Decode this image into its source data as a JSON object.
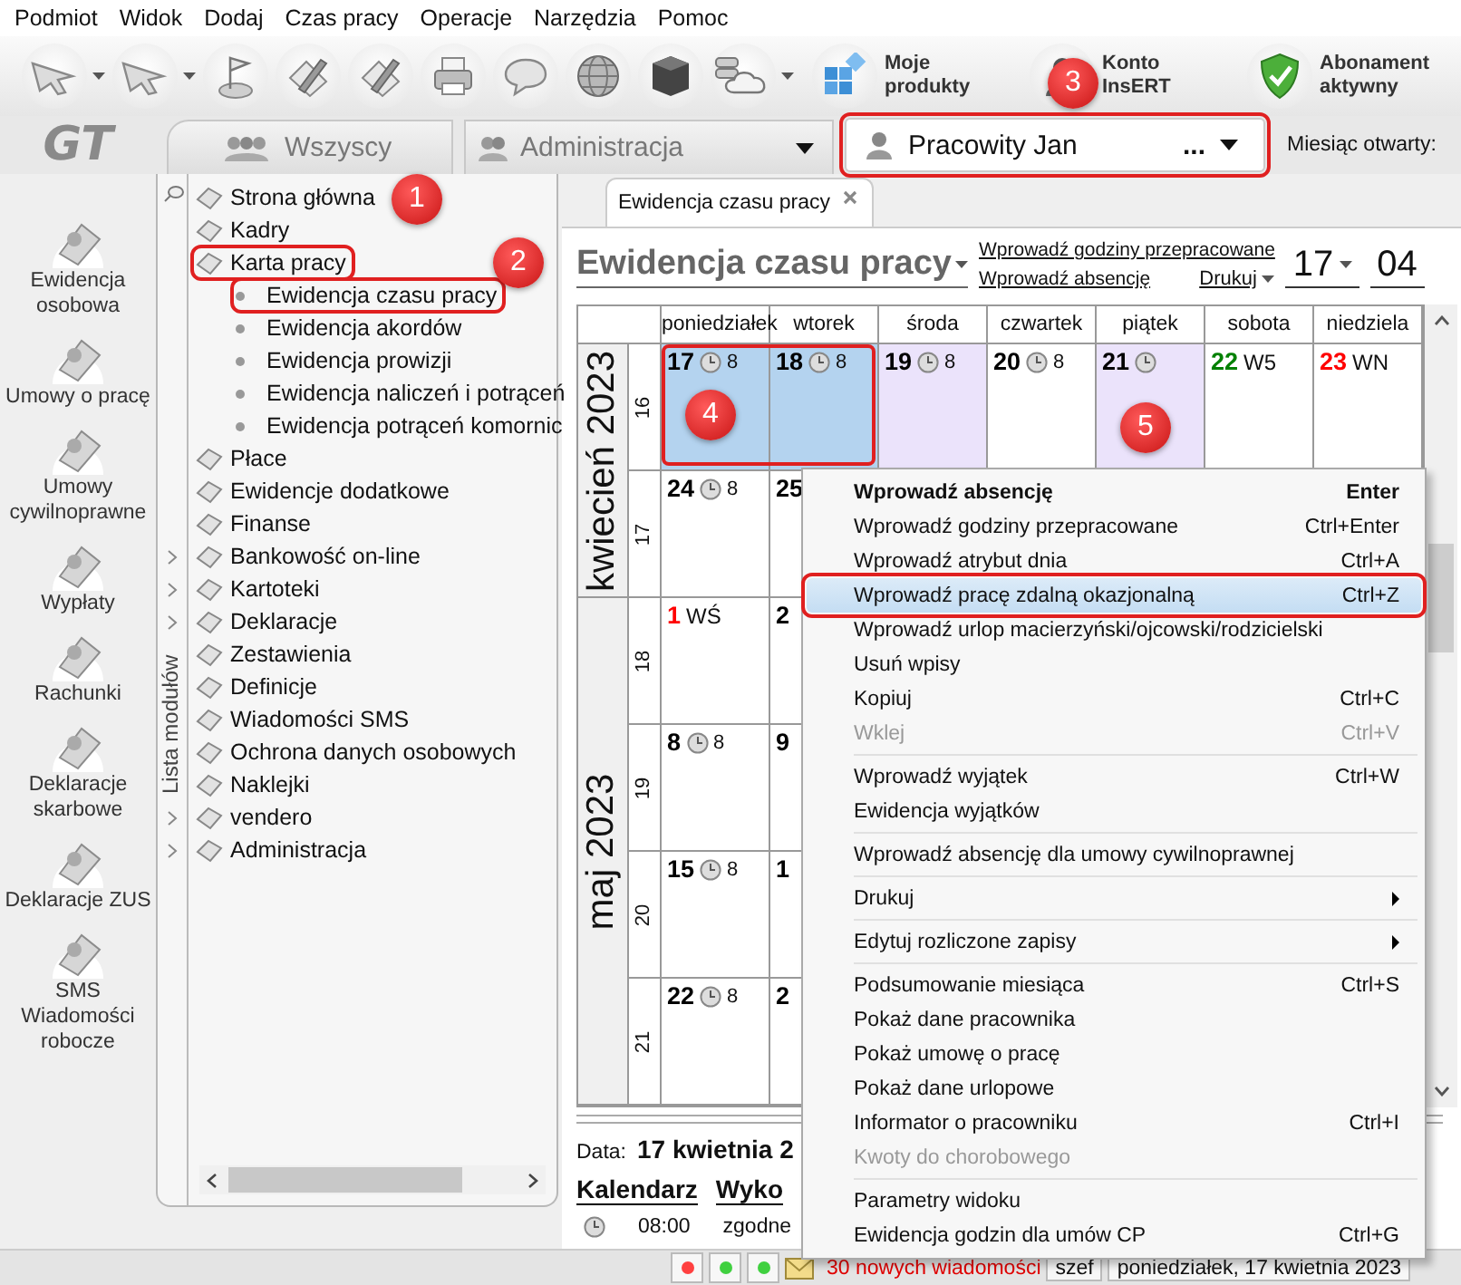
{
  "menubar": [
    "Podmiot",
    "Widok",
    "Dodaj",
    "Czas pracy",
    "Operacje",
    "Narzędzia",
    "Pomoc"
  ],
  "toolbar": [
    {
      "dropdown": true
    },
    {
      "dropdown": true
    },
    {
      "dropdown": false
    },
    {
      "dropdown": false
    },
    {
      "dropdown": false
    },
    {
      "dropdown": false
    },
    {
      "dropdown": false
    },
    {
      "dropdown": false
    },
    {
      "dropdown": false
    },
    {
      "dropdown": true
    },
    {
      "label": "Moje produkty",
      "dropdown": false
    },
    {
      "label": "Konto InsERT",
      "dropdown": false
    },
    {
      "label": "Abonament aktywny",
      "dropdown": false
    }
  ],
  "logo": "GT",
  "group_tab": {
    "label": "Wszyscy"
  },
  "group_dropdown": {
    "value": "Administracja"
  },
  "employee_selector": {
    "value": "Pracowity Jan",
    "more": "...",
    "outlined": true
  },
  "month_open_label": "Miesiąc otwarty:",
  "nav": [
    "Ewidencja osobowa",
    "Umowy o pracę",
    "Umowy cywilnoprawne",
    "Wypłaty",
    "Rachunki",
    "Deklaracje skarbowe",
    "Deklaracje ZUS",
    "SMS Wiadomości robocze"
  ],
  "modules": {
    "title": "Lista modułów",
    "items": [
      {
        "label": "Strona główna",
        "outlined": false
      },
      {
        "label": "Kadry",
        "outlined": false
      },
      {
        "label": "Karta pracy",
        "outlined": true,
        "children": [
          {
            "label": "Ewidencja czasu pracy",
            "outlined": true
          },
          {
            "label": "Ewidencja akordów",
            "outlined": false
          },
          {
            "label": "Ewidencja prowizji",
            "outlined": false
          },
          {
            "label": "Ewidencja naliczeń i potrąceń",
            "outlined": false
          },
          {
            "label": "Ewidencja potrąceń komornic",
            "outlined": false
          }
        ]
      },
      {
        "label": "Płace",
        "outlined": false
      },
      {
        "label": "Ewidencje dodatkowe",
        "outlined": false
      },
      {
        "label": "Finanse",
        "outlined": false
      },
      {
        "label": "Bankowość on-line",
        "chevron": true,
        "outlined": false
      },
      {
        "label": "Kartoteki",
        "chevron": true,
        "outlined": false
      },
      {
        "label": "Deklaracje",
        "chevron": true,
        "outlined": false
      },
      {
        "label": "Zestawienia",
        "outlined": false
      },
      {
        "label": "Definicje",
        "outlined": false
      },
      {
        "label": "Wiadomości SMS",
        "outlined": false
      },
      {
        "label": "Ochrona danych osobowych",
        "outlined": false
      },
      {
        "label": "Naklejki",
        "outlined": false
      },
      {
        "label": "vendero",
        "chevron": true,
        "outlined": false
      },
      {
        "label": "Administracja",
        "chevron": true,
        "outlined": false
      }
    ]
  },
  "document_tab": {
    "label": "Ewidencja czasu pracy"
  },
  "view_title": "Ewidencja czasu pracy",
  "links": [
    "Wprowadź godziny przepracowane",
    "Wprowadź absencję"
  ],
  "print_button": "Drukuj",
  "day_picker": "17",
  "month_picker": "04",
  "calendar": {
    "weekdays": [
      "poniedziałek",
      "wtorek",
      "środa",
      "czwartek",
      "piątek",
      "sobota",
      "niedziela"
    ],
    "months": [
      {
        "label": "kwiecień 2023",
        "weeks": [
          {
            "number": "16",
            "days": [
              {
                "day": "17",
                "hours": "8",
                "clock": true,
                "selected": true,
                "shaded": false,
                "outlined": true,
                "color": "#000000"
              },
              {
                "day": "18",
                "hours": "8",
                "clock": true,
                "selected": true,
                "shaded": false,
                "outlined": true,
                "color": "#000000"
              },
              {
                "day": "19",
                "hours": "8",
                "clock": true,
                "selected": false,
                "shaded": true,
                "outlined": false,
                "color": "#000000"
              },
              {
                "day": "20",
                "hours": "8",
                "clock": true,
                "selected": false,
                "shaded": false,
                "outlined": false,
                "color": "#000000"
              },
              {
                "day": "21",
                "clock": true,
                "selected": false,
                "shaded": true,
                "outlined": false,
                "color": "#000000"
              },
              {
                "day": "22",
                "code": "W5",
                "clock": false,
                "selected": false,
                "shaded": false,
                "outlined": false,
                "color": "#008000"
              },
              {
                "day": "23",
                "code": "WN",
                "clock": false,
                "selected": false,
                "shaded": false,
                "outlined": false,
                "color": "#ff0000"
              }
            ]
          },
          {
            "number": "17",
            "days": [
              {
                "day": "24",
                "hours": "8",
                "clock": true,
                "selected": false,
                "shaded": false,
                "outlined": false,
                "color": "#000000"
              },
              {
                "day": "25",
                "selected": false,
                "shaded": false,
                "outlined": false,
                "color": "#000000"
              }
            ]
          }
        ]
      },
      {
        "label": "maj 2023",
        "weeks": [
          {
            "number": "18",
            "days": [
              {
                "day": "1",
                "code": "WŚ",
                "clock": false,
                "selected": false,
                "shaded": false,
                "outlined": false,
                "color": "#ff0000"
              },
              {
                "day": "2",
                "selected": false,
                "shaded": false,
                "outlined": false,
                "color": "#000000"
              }
            ]
          },
          {
            "number": "19",
            "days": [
              {
                "day": "8",
                "hours": "8",
                "clock": true,
                "selected": false,
                "shaded": false,
                "outlined": false,
                "color": "#000000"
              },
              {
                "day": "9",
                "selected": false,
                "shaded": false,
                "outlined": false,
                "color": "#000000"
              }
            ]
          },
          {
            "number": "20",
            "days": [
              {
                "day": "15",
                "hours": "8",
                "clock": true,
                "selected": false,
                "shaded": false,
                "outlined": false,
                "color": "#000000"
              },
              {
                "day": "1",
                "selected": false,
                "shaded": false,
                "outlined": false,
                "color": "#000000"
              }
            ]
          },
          {
            "number": "21",
            "days": [
              {
                "day": "22",
                "hours": "8",
                "clock": true,
                "selected": false,
                "shaded": false,
                "outlined": false,
                "color": "#000000"
              },
              {
                "day": "2",
                "selected": false,
                "shaded": false,
                "outlined": false,
                "color": "#000000"
              }
            ]
          }
        ]
      }
    ]
  },
  "details": {
    "date_label": "Data:",
    "date_value": "17 kwietnia 2",
    "tabs": [
      "Kalendarz",
      "Wyko"
    ],
    "rows": [
      {
        "time": "08:00",
        "status": "zgodne"
      }
    ]
  },
  "context_menu": {
    "groups": [
      [
        {
          "label": "Wprowadź absencję",
          "shortcut": "Enter",
          "default": true,
          "disabled": false,
          "selected": false,
          "submenu": false,
          "outlined": false
        },
        {
          "label": "Wprowadź godziny przepracowane",
          "shortcut": "Ctrl+Enter",
          "default": false,
          "disabled": false,
          "selected": false,
          "submenu": false,
          "outlined": false
        },
        {
          "label": "Wprowadź atrybut dnia",
          "shortcut": "Ctrl+A",
          "default": false,
          "disabled": false,
          "selected": false,
          "submenu": false,
          "outlined": false
        },
        {
          "label": "Wprowadź pracę zdalną okazjonalną",
          "shortcut": "Ctrl+Z",
          "default": false,
          "disabled": false,
          "selected": true,
          "submenu": false,
          "outlined": true
        },
        {
          "label": "Wprowadź urlop macierzyński/ojcowski/rodzicielski",
          "default": false,
          "disabled": false,
          "selected": false,
          "submenu": false,
          "outlined": false
        },
        {
          "label": "Usuń wpisy",
          "default": false,
          "disabled": false,
          "selected": false,
          "submenu": false,
          "outlined": false
        },
        {
          "label": "Kopiuj",
          "shortcut": "Ctrl+C",
          "default": false,
          "disabled": false,
          "selected": false,
          "submenu": false,
          "outlined": false
        },
        {
          "label": "Wklej",
          "shortcut": "Ctrl+V",
          "default": false,
          "disabled": true,
          "selected": false,
          "submenu": false,
          "outlined": false
        }
      ],
      [
        {
          "label": "Wprowadź wyjątek",
          "shortcut": "Ctrl+W",
          "default": false,
          "disabled": false,
          "selected": false,
          "submenu": false,
          "outlined": false
        },
        {
          "label": "Ewidencja wyjątków",
          "default": false,
          "disabled": false,
          "selected": false,
          "submenu": false,
          "outlined": false
        }
      ],
      [
        {
          "label": "Wprowadź absencję dla umowy cywilnoprawnej",
          "default": false,
          "disabled": false,
          "selected": false,
          "submenu": false,
          "outlined": false
        }
      ],
      [
        {
          "label": "Drukuj",
          "default": false,
          "disabled": false,
          "selected": false,
          "submenu": true,
          "outlined": false
        }
      ],
      [
        {
          "label": "Edytuj rozliczone zapisy",
          "default": false,
          "disabled": false,
          "selected": false,
          "submenu": true,
          "outlined": false
        }
      ],
      [
        {
          "label": "Podsumowanie miesiąca",
          "shortcut": "Ctrl+S",
          "default": false,
          "disabled": false,
          "selected": false,
          "submenu": false,
          "outlined": false
        },
        {
          "label": "Pokaż dane pracownika",
          "default": false,
          "disabled": false,
          "selected": false,
          "submenu": false,
          "outlined": false
        },
        {
          "label": "Pokaż umowę o pracę",
          "default": false,
          "disabled": false,
          "selected": false,
          "submenu": false,
          "outlined": false
        },
        {
          "label": "Pokaż dane urlopowe",
          "default": false,
          "disabled": false,
          "selected": false,
          "submenu": false,
          "outlined": false
        },
        {
          "label": "Informator o pracowniku",
          "shortcut": "Ctrl+I",
          "default": false,
          "disabled": false,
          "selected": false,
          "submenu": false,
          "outlined": false
        },
        {
          "label": "Kwoty do chorobowego",
          "default": false,
          "disabled": true,
          "selected": false,
          "submenu": false,
          "outlined": false
        }
      ],
      [
        {
          "label": "Parametry widoku",
          "default": false,
          "disabled": false,
          "selected": false,
          "submenu": false,
          "outlined": false
        },
        {
          "label": "Ewidencja godzin dla umów CP",
          "shortcut": "Ctrl+G",
          "default": false,
          "disabled": false,
          "selected": false,
          "submenu": false,
          "outlined": false
        }
      ]
    ]
  },
  "status_bar": {
    "lights": [
      {
        "color": "#ff4040"
      },
      {
        "color": "#40d040"
      },
      {
        "color": "#40d040"
      }
    ],
    "message": "30 nowych wiadomości",
    "user": "szef",
    "date": "poniedziałek, 17 kwietnia 2023"
  },
  "markers": [
    "1",
    "2",
    "3",
    "4",
    "5"
  ]
}
